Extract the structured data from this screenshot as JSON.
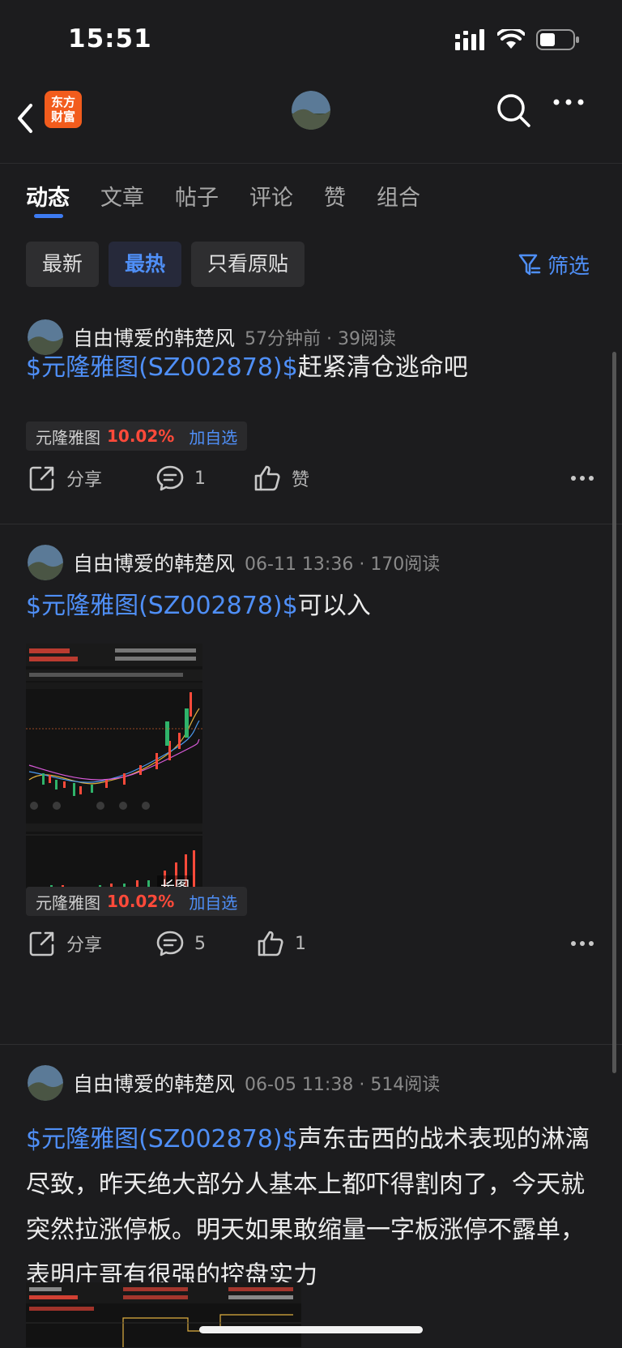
{
  "status": {
    "time": "15:51"
  },
  "nav": {
    "logo_line1": "东方",
    "logo_line2": "财富"
  },
  "tabs": [
    "动态",
    "文章",
    "帖子",
    "评论",
    "赞",
    "组合"
  ],
  "filters": [
    "最新",
    "最热",
    "只看原贴"
  ],
  "filter_btn": "筛选",
  "posts": [
    {
      "author": "自由博爱的韩楚风",
      "meta": "57分钟前 · 39阅读",
      "link": "$元隆雅图(SZ002878)$",
      "text": "赶紧清仓逃命吧",
      "tag": {
        "name": "元隆雅图",
        "pct": "10.02%",
        "add": "加自选"
      },
      "share": "分享",
      "comments": "1",
      "likes": "赞"
    },
    {
      "author": "自由博爱的韩楚风",
      "meta": "06-11 13:36 · 170阅读",
      "link": "$元隆雅图(SZ002878)$",
      "text": "可以入",
      "image_label": "长图",
      "tag": {
        "name": "元隆雅图",
        "pct": "10.02%",
        "add": "加自选"
      },
      "share": "分享",
      "comments": "5",
      "likes": "1"
    },
    {
      "author": "自由博爱的韩楚风",
      "meta": "06-05 11:38 · 514阅读",
      "link": "$元隆雅图(SZ002878)$",
      "text": "声东击西的战术表现的淋漓尽致，昨天绝大部分人基本上都吓得割肉了，今天就突然拉涨停板。明天如果敢缩量一字板涨停不露单，表明庄哥有很强的控盘实力"
    }
  ]
}
